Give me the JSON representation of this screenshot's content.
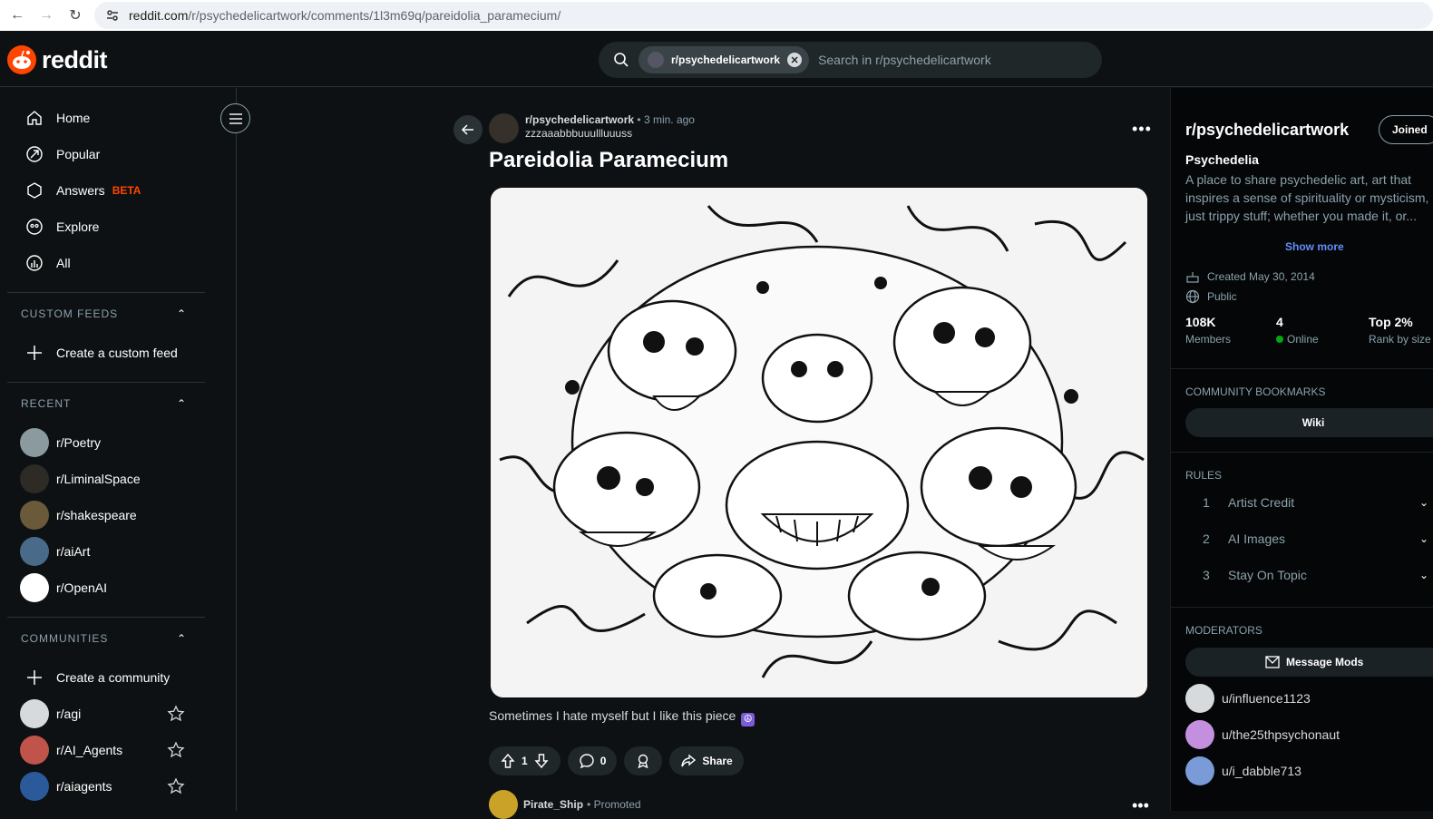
{
  "browser": {
    "url_host": "reddit.com",
    "url_path": "/r/psychedelicartwork/comments/1l3m69q/pareidolia_paramecium/"
  },
  "header": {
    "logo_text": "reddit",
    "search_chip": "r/psychedelicartwork",
    "search_placeholder": "Search in r/psychedelicartwork"
  },
  "sidebar": {
    "nav": [
      {
        "label": "Home",
        "icon": "home-icon"
      },
      {
        "label": "Popular",
        "icon": "popular-icon"
      },
      {
        "label": "Answers",
        "icon": "answers-icon",
        "badge": "BETA"
      },
      {
        "label": "Explore",
        "icon": "explore-icon"
      },
      {
        "label": "All",
        "icon": "all-icon"
      }
    ],
    "custom_feeds": {
      "heading": "CUSTOM FEEDS",
      "create_label": "Create a custom feed"
    },
    "recent": {
      "heading": "RECENT",
      "items": [
        "r/Poetry",
        "r/LiminalSpace",
        "r/shakespeare",
        "r/aiArt",
        "r/OpenAI"
      ]
    },
    "communities": {
      "heading": "COMMUNITIES",
      "create_label": "Create a community",
      "items": [
        "r/agi",
        "r/AI_Agents",
        "r/aiagents"
      ]
    }
  },
  "post": {
    "subreddit": "r/psychedelicartwork",
    "time": "• 3 min. ago",
    "author": "zzzaaabbbuuullluuuss",
    "title": "Pareidolia Paramecium",
    "body": "Sometimes I hate myself but I like this piece",
    "body_emoji": "☮",
    "votes": "1",
    "comments": "0",
    "share_label": "Share"
  },
  "promoted": {
    "name": "Pirate_Ship",
    "tag": "• Promoted"
  },
  "community": {
    "name": "r/psychedelicartwork",
    "join_label": "Joined",
    "title": "Psychedelia",
    "description_lines": [
      "A place to share psychedelic art, art that",
      "inspires a sense of spirituality or mysticism,",
      "just trippy stuff; whether you made it, or..."
    ],
    "show_more": "Show more",
    "created": "Created May 30, 2014",
    "visibility": "Public",
    "members_value": "108K",
    "members_label": "Members",
    "online_value": "4",
    "online_label": "Online",
    "rank_value": "Top 2%",
    "rank_label": "Rank by size",
    "bookmarks_heading": "COMMUNITY BOOKMARKS",
    "wiki_label": "Wiki",
    "rules_heading": "RULES",
    "rules": [
      {
        "n": "1",
        "t": "Artist Credit"
      },
      {
        "n": "2",
        "t": "AI Images"
      },
      {
        "n": "3",
        "t": "Stay On Topic"
      }
    ],
    "moderators_heading": "MODERATORS",
    "message_mods": "Message Mods",
    "mods": [
      "u/influence1123",
      "u/the25thpsychonaut",
      "u/i_dabble713"
    ]
  },
  "colors": {
    "brand": "#ff4500",
    "background": "#0e1113",
    "link": "#648efc",
    "online": "#01a816"
  }
}
